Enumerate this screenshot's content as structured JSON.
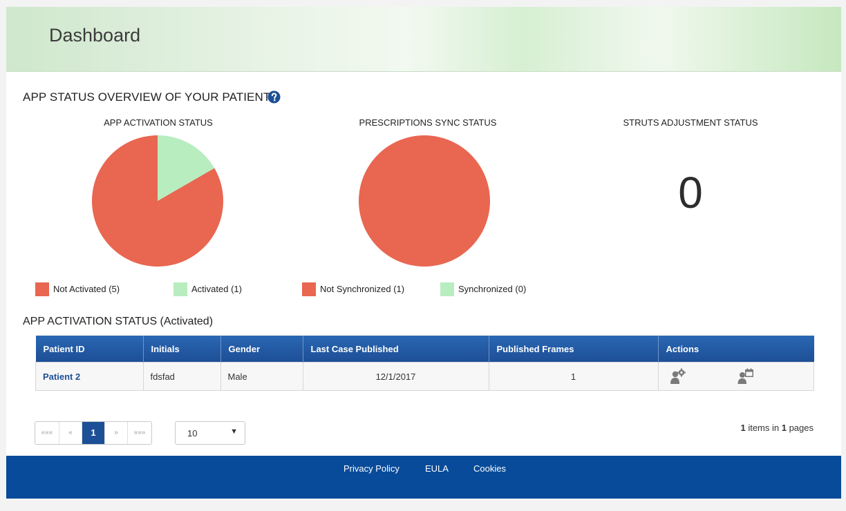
{
  "header": {
    "title": "Dashboard"
  },
  "overview": {
    "title": "APP STATUS OVERVIEW OF YOUR PATIENTS",
    "help_icon": "question-circle-icon"
  },
  "charts": {
    "activation": {
      "label": "APP ACTIVATION STATUS",
      "legend": [
        {
          "label": "Not Activated (5)",
          "color": "#e96651"
        },
        {
          "label": "Activated (1)",
          "color": "#b8edbf"
        }
      ]
    },
    "sync": {
      "label": "PRESCRIPTIONS SYNC STATUS",
      "legend": [
        {
          "label": "Not Synchronized (1)",
          "color": "#e96651"
        },
        {
          "label": "Synchronized (0)",
          "color": "#b8edbf"
        }
      ]
    },
    "struts": {
      "label": "STRUTS ADJUSTMENT STATUS",
      "value": "0"
    }
  },
  "chart_data": [
    {
      "type": "pie",
      "title": "APP ACTIVATION STATUS",
      "categories": [
        "Not Activated",
        "Activated"
      ],
      "values": [
        5,
        1
      ],
      "colors": [
        "#e96651",
        "#b8edbf"
      ]
    },
    {
      "type": "pie",
      "title": "PRESCRIPTIONS SYNC STATUS",
      "categories": [
        "Not Synchronized",
        "Synchronized"
      ],
      "values": [
        1,
        0
      ],
      "colors": [
        "#e96651",
        "#b8edbf"
      ]
    }
  ],
  "table": {
    "title": "APP ACTIVATION STATUS (Activated)",
    "columns": [
      "Patient ID",
      "Initials",
      "Gender",
      "Last Case Published",
      "Published Frames",
      "Actions"
    ],
    "rows": [
      {
        "patient_id": "Patient 2",
        "initials": "fdsfad",
        "gender": "Male",
        "last_case_published": "12/1/2017",
        "published_frames": "1",
        "actions": [
          "patient-settings-icon",
          "patient-calendar-icon"
        ]
      }
    ]
  },
  "pagination": {
    "first": "«««",
    "prev": "«",
    "current": "1",
    "next": "»",
    "last": "»»»",
    "page_size": "10",
    "info_count": "1",
    "info_mid": " items in ",
    "info_pages": "1",
    "info_end": " pages"
  },
  "footer": {
    "links": [
      "Privacy Policy",
      "EULA",
      "Cookies"
    ]
  },
  "colors": {
    "brand_blue": "#1d4f96",
    "footer_blue": "#084b9a",
    "pie_red": "#e96651",
    "pie_green": "#b8edbf"
  }
}
